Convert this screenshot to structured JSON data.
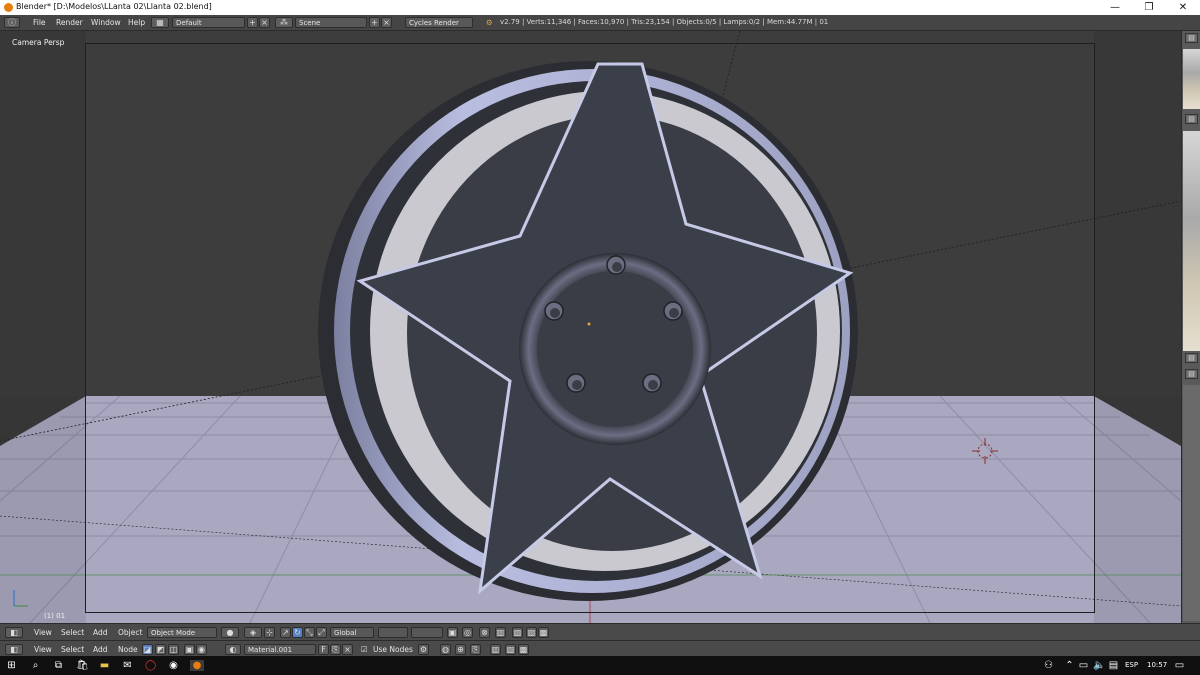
{
  "window": {
    "title": "Blender* [D:\\Modelos\\LLanta 02\\Llanta 02.blend]",
    "controls": [
      "—",
      "❐",
      "✕"
    ]
  },
  "info_header": {
    "menus": [
      "File",
      "Render",
      "Window",
      "Help"
    ],
    "layout_value": "Default",
    "scene_value": "Scene",
    "engine_value": "Cycles Render",
    "stats": "v2.79 | Verts:11,346 | Faces:10,970 | Tris:23,154 | Objects:0/5 | Lamps:0/2 | Mem:44.77M | 01"
  },
  "viewport": {
    "label": "Camera Persp",
    "frame_label": "(1) 01",
    "colors": {
      "background": "#3c3c3c",
      "floor": "#aeadc5",
      "wheel_face": "#3b3f49",
      "rim": "#b3b6d9",
      "rim_inner": "#d8d8dc"
    }
  },
  "view3d_header": {
    "menus": [
      "View",
      "Select",
      "Add",
      "Object"
    ],
    "mode_value": "Object Mode",
    "orientation_value": "Global"
  },
  "node_header": {
    "menus": [
      "View",
      "Select",
      "Add",
      "Node"
    ],
    "material_value": "Material.001",
    "fake_user": "F",
    "use_nodes_label": "Use Nodes"
  },
  "taskbar": {
    "language": "ESP",
    "time": "10:57"
  }
}
